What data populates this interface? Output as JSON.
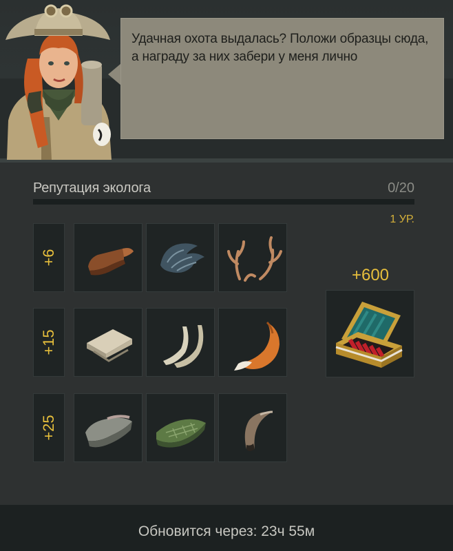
{
  "dialog": {
    "text": "Удачная охота выдалась? Положи образцы сюда, а награду за них забери у меня лично"
  },
  "reputation": {
    "label": "Репутация эколога",
    "count_text": "0/20",
    "progress": 0,
    "level_text": "1 УР."
  },
  "tiers": [
    {
      "bonus": "+6",
      "items": [
        "leather-hide-icon",
        "gray-fur-icon",
        "antlers-icon"
      ]
    },
    {
      "bonus": "+15",
      "items": [
        "rolled-pelt-icon",
        "tusks-icon",
        "fox-tail-icon"
      ]
    },
    {
      "bonus": "+25",
      "items": [
        "gray-pelt-icon",
        "green-scaled-hide-icon",
        "horn-icon"
      ]
    }
  ],
  "reward": {
    "amount": "+600",
    "icon": "ammo-case-icon"
  },
  "footer": {
    "text": "Обновится через: 23ч 55м"
  },
  "colors": {
    "accent": "#e7bf3c",
    "background": "#2e3131",
    "dialog_bg": "#8d897b"
  }
}
